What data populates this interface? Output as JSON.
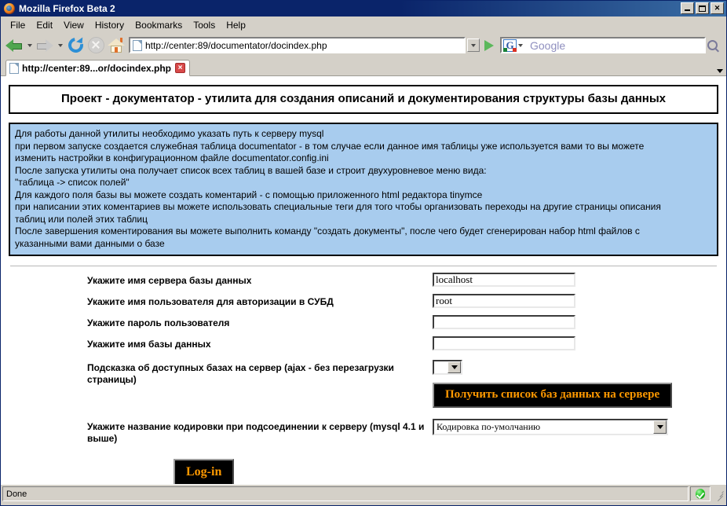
{
  "window": {
    "title": "Mozilla Firefox Beta 2",
    "icon": "firefox-icon",
    "minimize_label": "",
    "maximize_label": "",
    "close_label": "✕"
  },
  "menubar": {
    "items": [
      {
        "label": "File"
      },
      {
        "label": "Edit"
      },
      {
        "label": "View"
      },
      {
        "label": "History"
      },
      {
        "label": "Bookmarks"
      },
      {
        "label": "Tools"
      },
      {
        "label": "Help"
      }
    ]
  },
  "toolbar": {
    "back_icon": "back-arrow-icon",
    "forward_icon": "forward-arrow-icon",
    "reload_icon": "reload-icon",
    "stop_icon": "stop-icon",
    "home_icon": "home-icon",
    "url": "http://center:89/documentator/docindex.php",
    "go_icon": "go-icon",
    "search_engine": "G",
    "search_placeholder": "Google",
    "search_icon": "magnifier-icon"
  },
  "tabs": {
    "items": [
      {
        "label": "http://center:89...or/docindex.php",
        "close_label": "×"
      }
    ],
    "list_icon": "chevron-down-icon"
  },
  "page": {
    "title": "Проект - документатор - утилита для создания описаний и документирования структуры базы данных",
    "info_lines": [
      "Для работы данной утилиты необходимо указать путь к серверу mysql",
      "при первом запуске создается служебная таблица documentator - в том случае если данное имя таблицы уже используется вами то вы можете",
      "изменить настройки в конфигурационном файле documentator.config.ini",
      "После запуска утилиты она получает список всех таблиц в вашей базе и строит двухуровневое меню вида:",
      "\"таблица -> список полей\"",
      "Для каждого поля базы вы можете создать коментарий - с помощью приложенного html редактора tinymce",
      "при написании этих коментариев вы можете использовать специальные теги для того чтобы организовать переходы на другие страницы описания",
      "таблиц или полей этих таблиц",
      "После завершения коментирования вы можете выполнить команду \"создать документы\", после чего будет сгенерирован набор html файлов с",
      "указанными вами данными о базе"
    ],
    "form": {
      "rows": [
        {
          "label": "Укажите имя сервера базы данных",
          "field_type": "text",
          "value": "localhost",
          "name": "db-server-input"
        },
        {
          "label": "Укажите имя пользователя для авторизации в СУБД",
          "field_type": "text",
          "value": "root",
          "name": "db-user-input"
        },
        {
          "label": "Укажите пароль пользователя",
          "field_type": "text",
          "value": "",
          "name": "db-password-input"
        },
        {
          "label": "Укажите имя базы данных",
          "field_type": "text",
          "value": "",
          "name": "db-name-input"
        },
        {
          "label": "Подсказка об доступных базах на сервер (ajax - без перезагрузки страницы)",
          "field_type": "select-small",
          "value": "",
          "name": "db-hint-select"
        }
      ],
      "get_databases_button": "Получить список баз данных на сервере",
      "charset_label": "Укажите название кодировки при подсоединении к серверу (mysql 4.1 и выше)",
      "charset_value": "Кодировка по-умолчанию",
      "login_button": "Log-in"
    }
  },
  "statusbar": {
    "text": "Done",
    "secure_icon": "green-check-icon"
  },
  "colors": {
    "titlebar": "#0a246a",
    "chrome": "#d4d0c8",
    "info_box": "#a8ccee",
    "button_bg": "#000000",
    "button_text": "#ff9900"
  }
}
